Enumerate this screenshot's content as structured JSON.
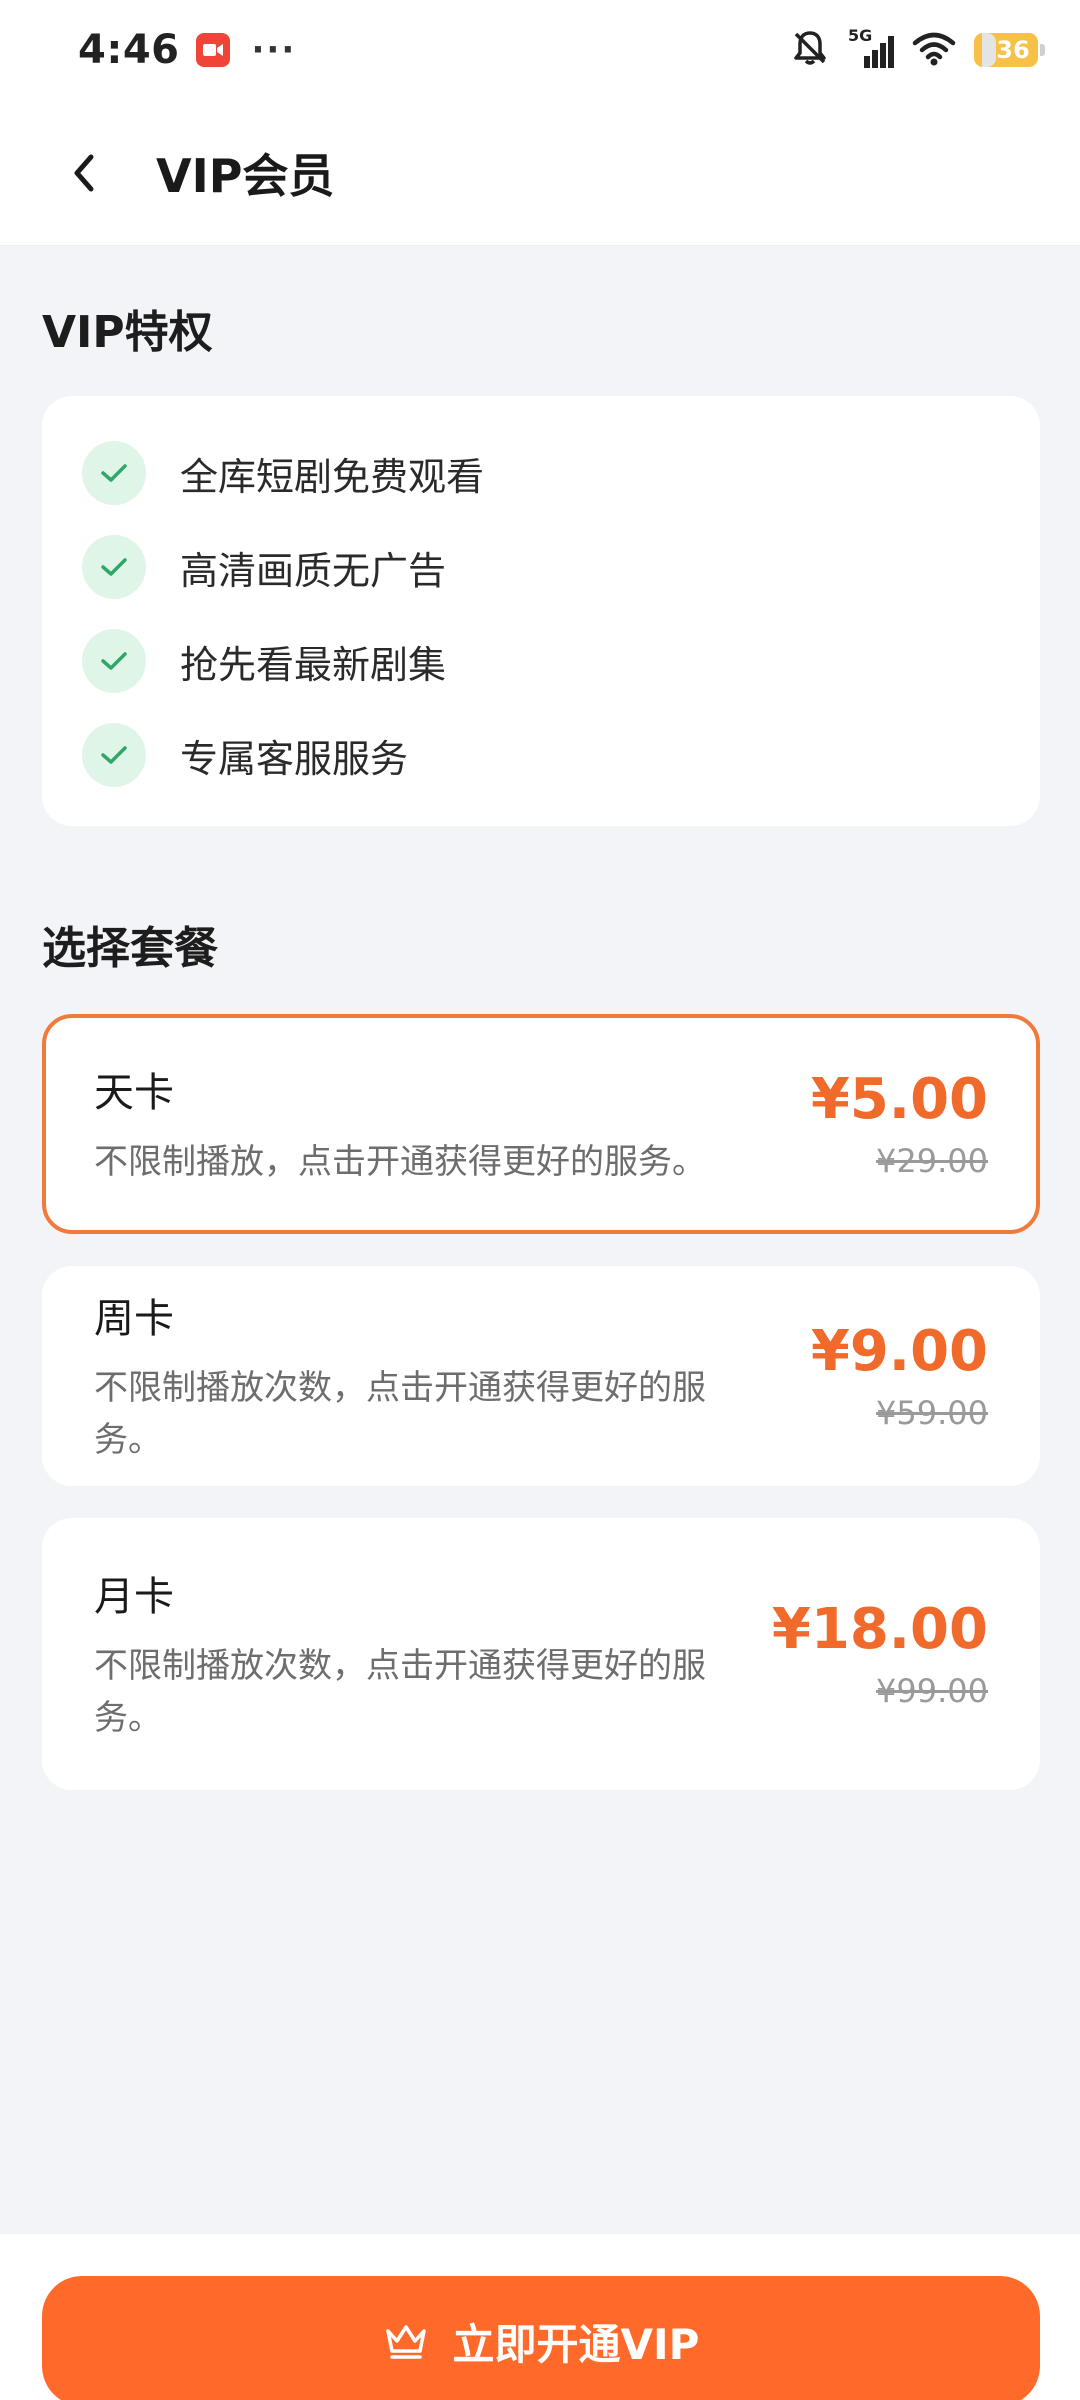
{
  "status_bar": {
    "time": "4:46",
    "more": "···",
    "network": "5G",
    "battery": "36",
    "icons": [
      "screen-record-icon",
      "mute-bell-icon",
      "signal-icon",
      "wifi-icon",
      "battery-icon"
    ]
  },
  "header": {
    "title": "VIP会员"
  },
  "benefits": {
    "title": "VIP特权",
    "items": [
      {
        "label": "全库短剧免费观看"
      },
      {
        "label": "高清画质无广告"
      },
      {
        "label": "抢先看最新剧集"
      },
      {
        "label": "专属客服服务"
      }
    ]
  },
  "plans": {
    "title": "选择套餐",
    "items": [
      {
        "name": "天卡",
        "desc": "不限制播放，点击开通获得更好的服务。",
        "price": "¥5.00",
        "original_price": "¥29.00",
        "selected": true
      },
      {
        "name": "周卡",
        "desc": "不限制播放次数，点击开通获得更好的服务。",
        "price": "¥9.00",
        "original_price": "¥59.00",
        "selected": false
      },
      {
        "name": "月卡",
        "desc": "不限制播放次数，点击开通获得更好的服务。",
        "price": "¥18.00",
        "original_price": "¥99.00",
        "selected": false
      }
    ]
  },
  "cta": {
    "label": "立即开通VIP"
  },
  "colors": {
    "accent": "#ff6a2a",
    "price": "#f06a2c",
    "check_bg": "#dff5e7",
    "check": "#2ea868"
  }
}
